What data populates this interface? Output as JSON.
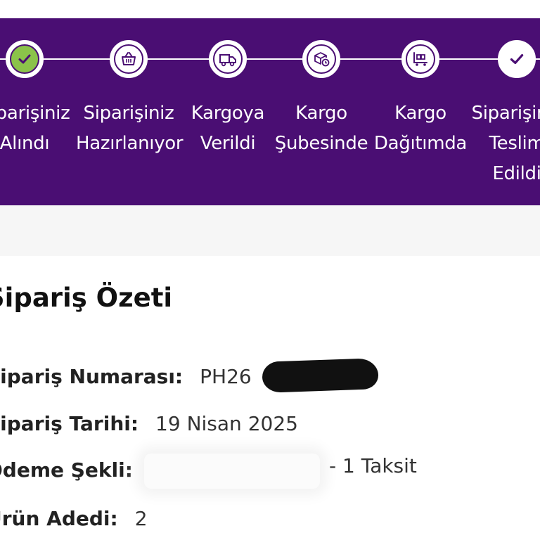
{
  "colors": {
    "tracker_bg": "#4a0e73",
    "done_fill": "#8bc34a",
    "text_dark": "#111111"
  },
  "tracker": {
    "steps": [
      {
        "line1": "Siparişiniz",
        "line2": "Alındı",
        "line3": "",
        "icon": "check-icon",
        "status": "completed"
      },
      {
        "line1": "Siparişiniz",
        "line2": "Hazırlanıyor",
        "line3": "",
        "icon": "basket-icon",
        "status": "pending"
      },
      {
        "line1": "Kargoya",
        "line2": "Verildi",
        "line3": "",
        "icon": "truck-icon",
        "status": "pending"
      },
      {
        "line1": "Kargo",
        "line2": "Şubesinde",
        "line3": "",
        "icon": "package-clock-icon",
        "status": "pending"
      },
      {
        "line1": "Kargo",
        "line2": "Dağıtımda",
        "line3": "",
        "icon": "cart-icon",
        "status": "pending"
      },
      {
        "line1": "Siparişiniz",
        "line2": "Teslim",
        "line3": "Edildi",
        "icon": "check-icon",
        "status": "pending"
      }
    ]
  },
  "summary": {
    "title": "Sipariş Özeti",
    "order_number": {
      "label": "Sipariş Numarası:",
      "value": "PH26"
    },
    "order_date": {
      "label": "Sipariş Tarihi:",
      "value": "19 Nisan 2025"
    },
    "payment": {
      "label": "Ödeme Şekli:",
      "value": "- 1 Taksit"
    },
    "item_count": {
      "label": "Ürün Adedi:",
      "value": "2"
    }
  }
}
